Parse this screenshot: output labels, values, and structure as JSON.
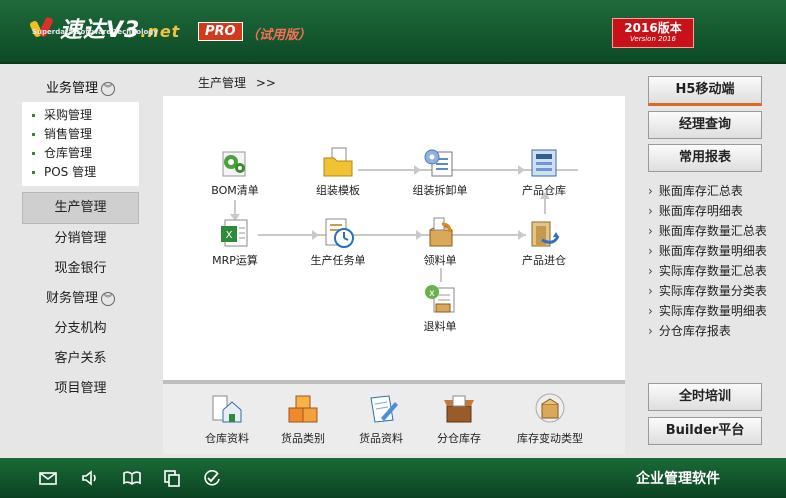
{
  "header": {
    "logo_text": "速达V3",
    "logo_net": ".net",
    "logo_sub": "Superdata Software Technology",
    "pro": "PRO",
    "trial": "（试用版）",
    "version_main": "2016版本",
    "version_sub": "Version 2016"
  },
  "sidebar": {
    "group1": {
      "label": "业务管理",
      "items": [
        {
          "label": "采购管理"
        },
        {
          "label": "销售管理"
        },
        {
          "label": "仓库管理"
        },
        {
          "label": "POS 管理"
        }
      ]
    },
    "items": [
      {
        "label": "生产管理"
      },
      {
        "label": "分销管理"
      },
      {
        "label": "现金银行"
      }
    ],
    "group2": {
      "label": "财务管理"
    },
    "items2": [
      {
        "label": "分支机构"
      },
      {
        "label": "客户关系"
      },
      {
        "label": "项目管理"
      }
    ]
  },
  "breadcrumb": {
    "label": "生产管理",
    "sep": ">>"
  },
  "flow": {
    "nodes": [
      {
        "label": "BOM清单"
      },
      {
        "label": "组装模板"
      },
      {
        "label": "组装拆卸单"
      },
      {
        "label": "产品仓库"
      },
      {
        "label": "MRP运算"
      },
      {
        "label": "生产任务单"
      },
      {
        "label": "领料单"
      },
      {
        "label": "产品进仓"
      },
      {
        "label": "退料单"
      }
    ]
  },
  "bottom": {
    "items": [
      {
        "label": "仓库资料"
      },
      {
        "label": "货品类别"
      },
      {
        "label": "货品资料"
      },
      {
        "label": "分仓库存"
      },
      {
        "label": "库存变动类型"
      }
    ]
  },
  "right": {
    "h5": "H5移动端",
    "manager": "经理查询",
    "reports_btn": "常用报表",
    "reports": [
      {
        "label": "账面库存汇总表"
      },
      {
        "label": "账面库存明细表"
      },
      {
        "label": "账面库存数量汇总表"
      },
      {
        "label": "账面库存数量明细表"
      },
      {
        "label": "实际库存数量汇总表"
      },
      {
        "label": "实际库存数量分类表"
      },
      {
        "label": "实际库存数量明细表"
      },
      {
        "label": "分仓库存报表"
      }
    ],
    "training": "全时培训",
    "builder": "Builder平台"
  },
  "footer": {
    "text": "企业管理软件"
  },
  "colors": {
    "header_green": "#0c4a26",
    "accent_red": "#c8121a",
    "orange_accent": "#d96a2a"
  }
}
